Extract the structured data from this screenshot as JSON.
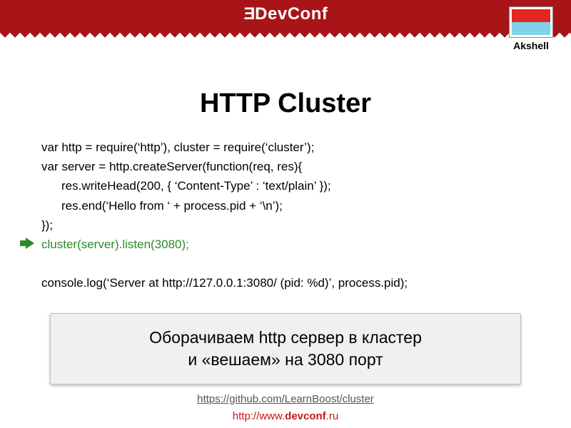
{
  "header": {
    "brand_left": "Dev",
    "brand_right": "onf"
  },
  "logo": {
    "label": "Akshell"
  },
  "title": "HTTP Cluster",
  "code": {
    "l1": "var http = require(‘http’), cluster = require(‘cluster’);",
    "l2": "var server = http.createServer(function(req, res){",
    "l3": "res.writeHead(200, { ‘Content-Type’ : ‘text/plain’ });",
    "l4": "res.end(‘Hello from ‘ + process.pid + ‘\\n’);",
    "l5": "});",
    "l6": "cluster(server).listen(3080);",
    "l7": "console.log(‘Server at http://127.0.0.1:3080/ (pid: %d)’, process.pid);"
  },
  "callout": {
    "line1": "Оборачиваем http сервер в кластер",
    "line2": "и «вешаем» на 3080 порт"
  },
  "source_url": "https://github.com/LearnBoost/cluster",
  "footer": {
    "prefix": "http://www.",
    "bold": "devconf",
    "suffix": ".ru"
  }
}
